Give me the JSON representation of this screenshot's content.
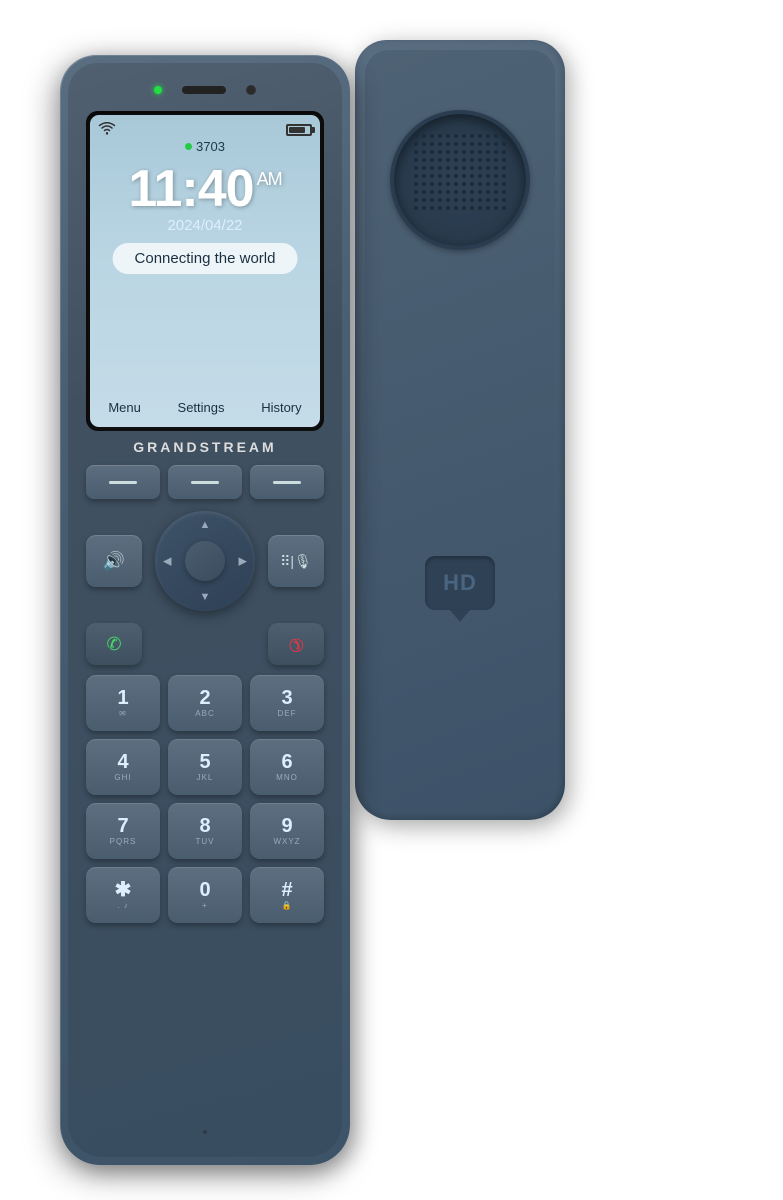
{
  "scene": {
    "bg_color": "#ffffff"
  },
  "screen": {
    "extension": "3703",
    "time": "11:40",
    "ampm": "AM",
    "date": "2024/04/22",
    "connecting_text": "Connecting the world",
    "softkeys": [
      "Menu",
      "Settings",
      "History"
    ]
  },
  "brand": "GRANDSTREAM",
  "keypad": {
    "softkey_lines": [
      "—",
      "—",
      "—"
    ],
    "digits": [
      {
        "main": "1",
        "sub": "✉"
      },
      {
        "main": "2",
        "sub": "ABC"
      },
      {
        "main": "3",
        "sub": "DEF"
      },
      {
        "main": "4",
        "sub": "GHI"
      },
      {
        "main": "5",
        "sub": "JKL"
      },
      {
        "main": "6",
        "sub": "MNO"
      },
      {
        "main": "7",
        "sub": "PQRS"
      },
      {
        "main": "8",
        "sub": "TUV"
      },
      {
        "main": "9",
        "sub": "WXYZ"
      },
      {
        "main": "✱",
        "sub": ".:"
      },
      {
        "main": "0",
        "sub": "+"
      },
      {
        "main": "#",
        "sub": "🔒"
      }
    ]
  },
  "back": {
    "hd_label": "HD"
  },
  "icons": {
    "wifi": "((°))",
    "battery": "battery",
    "speaker": "🔊",
    "conference_mute": "⠿✂",
    "call": "📞",
    "end_call": "📵",
    "up_arrow": "▲",
    "down_arrow": "▼",
    "left_arrow": "◀",
    "right_arrow": "▶"
  }
}
